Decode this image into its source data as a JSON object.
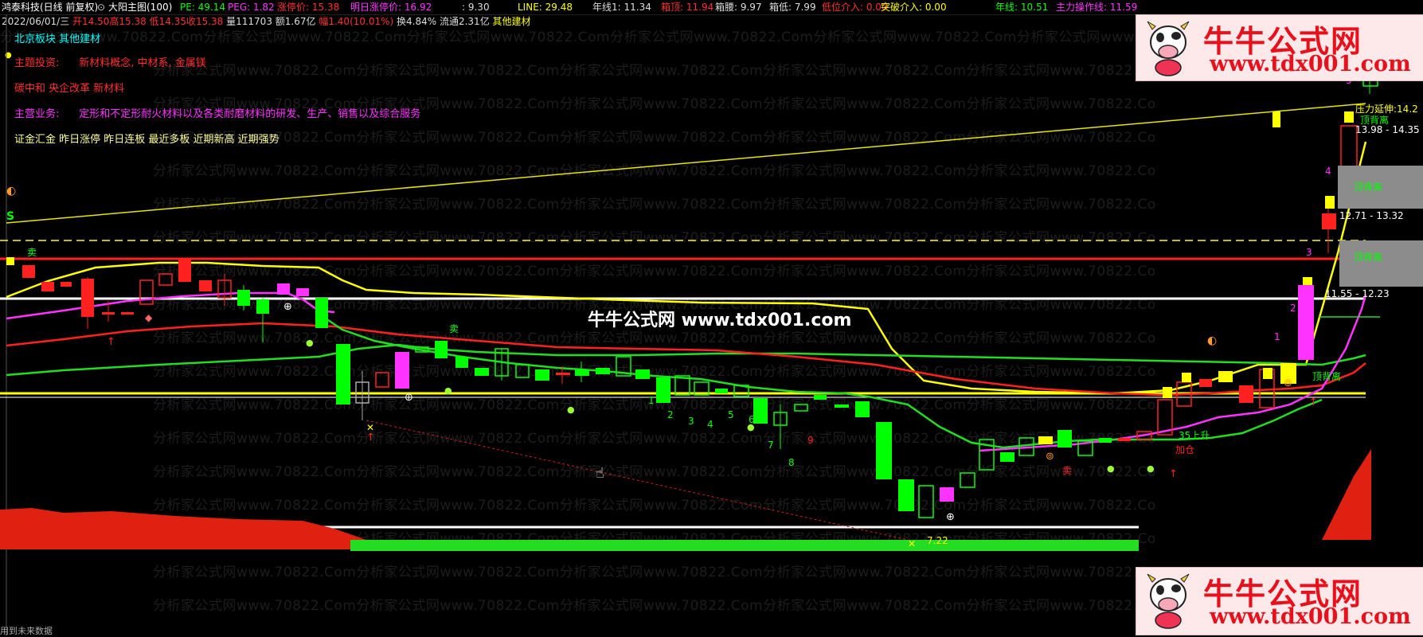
{
  "header": {
    "stock": "鸿泰科技(日线 前复权)",
    "main_chart": "大阳主图(100)",
    "pe": "PE: 49.14",
    "peg": "PEG: 1.82",
    "limit_up": "涨停价: 15.38",
    "next_limit": "明日涨停价: 16.92",
    "val930": ": 9.30",
    "line": "LINE: 29.48",
    "annual": "年线1: 11.34",
    "box_top": "箱顶: 11.94",
    "box_waist": "箱腰: 9.97",
    "box_bottom": "箱低: 7.99",
    "low_entry": "低位介入: 0.00",
    "breakout": "突破介入: 0.00",
    "annual2": "年线: 10.51",
    "main_op": "主力操作线: 11.59"
  },
  "subheader": {
    "date": "2022/06/01/三",
    "open": "开14.50",
    "high": "高15.38",
    "low": "低14.35",
    "close": "收15.38",
    "volume": "量111703",
    "amount": "额1.67亿",
    "change": "幅1.40(10.01%)",
    "turnover": "换4.84%",
    "float": "流通2.31亿",
    "sector": "其他建材"
  },
  "info": {
    "board_label": "北京板块",
    "board_value": "其他建材",
    "theme_label": "主题投资:",
    "theme_value": "新材料概念, 中材系, 金属镁",
    "tags": "碳中和 央企改革 新材料",
    "business_label": "主营业务:",
    "business_value": "定形和不定形耐火材料以及各类耐磨材料的研发、生产、销售以及综合服务",
    "signals": "证金汇金 昨日涨停 昨日连板 最近多板 近期新高 近期强势"
  },
  "watermark": "分析家公式网www.70822.Com",
  "banner": "牛牛公式网 www.tdx001.com",
  "logo": {
    "title": "牛牛公式网",
    "url": "www.tdx001.com"
  },
  "zones": [
    {
      "label": "压力延伸:14.2",
      "sub": "顶背离",
      "range": "13.98 - 14.35"
    },
    {
      "label": "顶背离",
      "range": "12.71 - 13.32"
    },
    {
      "label": "顶背离",
      "range": "11.55 - 12.23"
    }
  ],
  "signals_on_chart": {
    "sell": "卖",
    "s_mark": "S",
    "top_div": "顶背离",
    "up_35": "35上升",
    "add": "加仓",
    "sell2": "卖",
    "buy_point": "7.22"
  },
  "wave_numbers": [
    "1",
    "2",
    "3",
    "4",
    "5"
  ],
  "count_numbers": [
    "1",
    "2",
    "3",
    "4",
    "5",
    "6",
    "7",
    "8",
    "9"
  ],
  "status": "用到未来数据",
  "colors": {
    "up": "#ff2020",
    "down": "#00ff00",
    "ma_yellow": "#ffff00",
    "ma_green": "#22dd22",
    "ma_red": "#ff2020",
    "ma_magenta": "#ff33ff",
    "white": "#ffffff"
  }
}
